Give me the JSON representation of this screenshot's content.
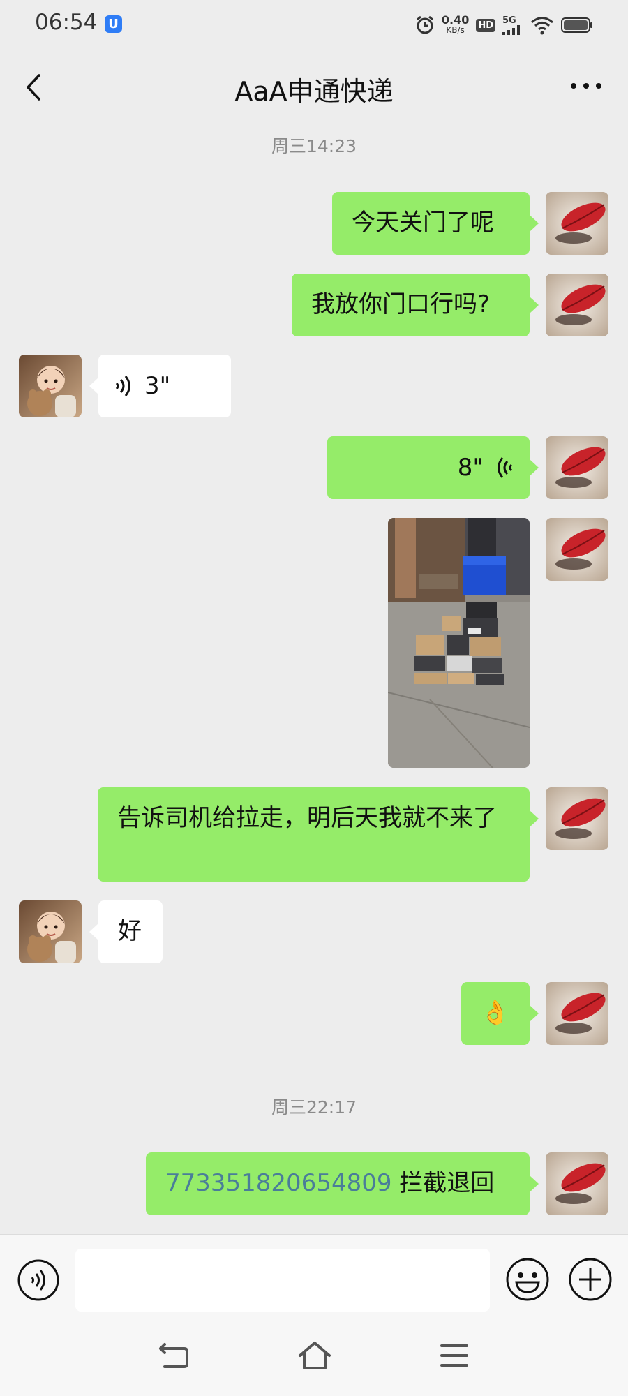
{
  "status_bar": {
    "time": "06:54",
    "shield_glyph": "U",
    "net_speed_value": "0.40",
    "net_speed_unit": "KB/s",
    "hd_label": "HD",
    "network_label": "5G",
    "icons": [
      "shield-icon",
      "alarm-icon",
      "hd-icon",
      "signal-5g-icon",
      "wifi-icon",
      "battery-icon"
    ]
  },
  "header": {
    "title": "AaA申通快递",
    "back_icon": "chevron-left-icon",
    "more_icon": "more-dots-icon"
  },
  "messages": {
    "timestamp_1": "周三14:23",
    "m1_text": "今天关门了呢",
    "m2_text": "我放你门口行吗?",
    "m3_voice_duration": "3\"",
    "m4_voice_duration": "8\"",
    "m5_photo_alt": "photo of stacked parcels at a doorway",
    "m6_text": "告诉司机给拉走，明后天我就不来了",
    "m7_text": "好",
    "m8_emoji": "👌",
    "timestamp_2": "周三22:17",
    "m9_tracking_number": "773351820654809",
    "m9_text": " 拦截退回"
  },
  "input_bar": {
    "placeholder": "",
    "voice_icon": "voice-input-icon",
    "emoji_icon": "emoji-icon",
    "plus_icon": "plus-icon"
  },
  "nav_bar": {
    "icons": [
      "back-nav-icon",
      "home-nav-icon",
      "menu-nav-icon"
    ]
  },
  "colors": {
    "background": "#ededed",
    "my_bubble": "#95ec69",
    "peer_bubble": "#ffffff",
    "tracking_link": "#4a7d99"
  }
}
